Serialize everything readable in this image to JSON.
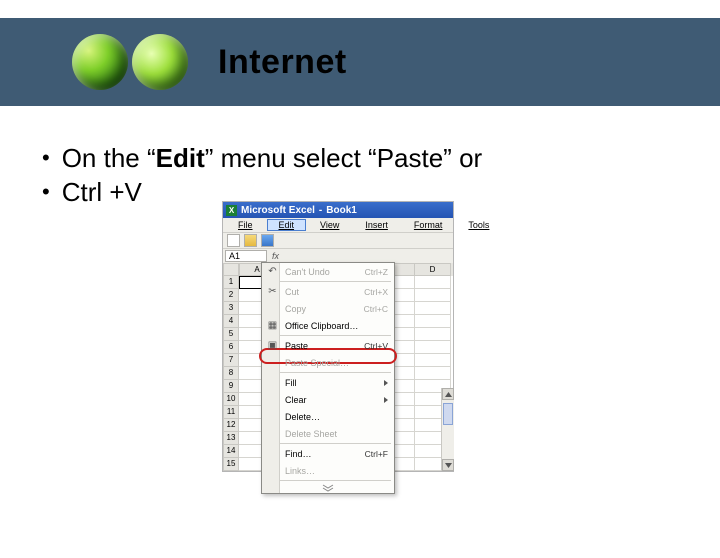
{
  "header": {
    "title": "Internet"
  },
  "bullets": [
    {
      "pre": "On the “",
      "bold": "Edit",
      "post": "” menu select “Paste” or"
    },
    {
      "pre": "Ctrl +V",
      "bold": "",
      "post": ""
    }
  ],
  "excel": {
    "app_name": "Microsoft Excel",
    "doc_name": "Book1",
    "separator": " - ",
    "excel_glyph": "X",
    "menus": {
      "file": "File",
      "edit": "Edit",
      "view": "View",
      "insert": "Insert",
      "format": "Format",
      "tools": "Tools"
    },
    "namebox": "A1",
    "fx": "fx",
    "col_headers": [
      "A",
      "D"
    ],
    "row_headers": [
      "1",
      "2",
      "3",
      "4",
      "5",
      "6",
      "7",
      "8",
      "9",
      "10",
      "11",
      "12",
      "13",
      "14",
      "15"
    ],
    "edit_menu": {
      "undo": {
        "label": "Can't Undo",
        "shortcut": "Ctrl+Z",
        "icon": "↶",
        "dim": true
      },
      "cut": {
        "label": "Cut",
        "shortcut": "Ctrl+X",
        "icon": "✂",
        "dim": true
      },
      "copy": {
        "label": "Copy",
        "shortcut": "Ctrl+C",
        "icon": "",
        "dim": true
      },
      "office_cb": {
        "label": "Office Clipboard…",
        "shortcut": "",
        "icon": "▦",
        "dim": false
      },
      "paste": {
        "label": "Paste",
        "shortcut": "Ctrl+V",
        "icon": "▣",
        "dim": false
      },
      "paste_special": {
        "label": "Paste Special…",
        "shortcut": "",
        "icon": "",
        "dim": true
      },
      "fill": {
        "label": "Fill",
        "shortcut": "",
        "icon": "",
        "submenu": true,
        "dim": false
      },
      "clear": {
        "label": "Clear",
        "shortcut": "",
        "icon": "",
        "submenu": true,
        "dim": false
      },
      "delete": {
        "label": "Delete…",
        "shortcut": "",
        "icon": "",
        "dim": false
      },
      "delete_sheet": {
        "label": "Delete Sheet",
        "shortcut": "",
        "icon": "",
        "dim": true
      },
      "find": {
        "label": "Find…",
        "shortcut": "Ctrl+F",
        "icon": "",
        "dim": false
      },
      "links": {
        "label": "Links…",
        "shortcut": "",
        "icon": "",
        "dim": true
      }
    }
  }
}
